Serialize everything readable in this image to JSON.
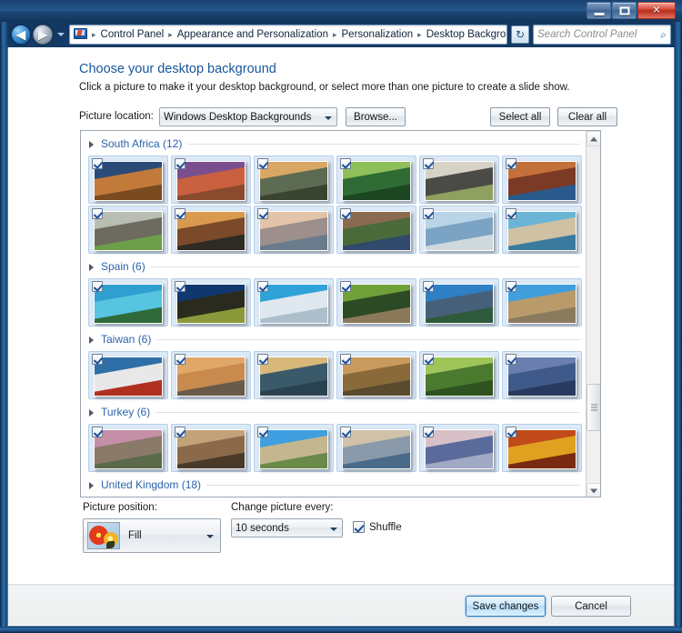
{
  "window": {
    "minimize_label": "Minimize",
    "maximize_label": "Maximize",
    "close_label": "Close",
    "close_glyph": "✕"
  },
  "nav": {
    "back_glyph": "◀",
    "forward_glyph": "▶",
    "refresh_glyph": "↻",
    "breadcrumbs": [
      "Control Panel",
      "Appearance and Personalization",
      "Personalization",
      "Desktop Background"
    ],
    "separator": "▸"
  },
  "search": {
    "placeholder": "Search Control Panel",
    "icon": "search-icon",
    "glyph": "⌕"
  },
  "page": {
    "title": "Choose your desktop background",
    "subtitle": "Click a picture to make it your desktop background, or select more than one picture to create a slide show."
  },
  "location": {
    "label": "Picture location:",
    "value": "Windows Desktop Backgrounds",
    "browse_label": "Browse...",
    "select_all_label": "Select all",
    "clear_all_label": "Clear all"
  },
  "gallery": {
    "sections": [
      {
        "name": "South Africa",
        "count": "(12)",
        "label": "South Africa (12)",
        "rows": [
          [
            {
              "checked": true,
              "c1": "#2a4a78",
              "c2": "#c27a3a",
              "c3": "#7a4a20"
            },
            {
              "checked": true,
              "c1": "#7b4e8e",
              "c2": "#c9603f",
              "c3": "#8a4a2e"
            },
            {
              "checked": true,
              "c1": "#d8a766",
              "c2": "#5d6b52",
              "c3": "#3a4430"
            },
            {
              "checked": true,
              "c1": "#8fbf5a",
              "c2": "#2f6b35",
              "c3": "#1d4622"
            },
            {
              "checked": true,
              "c1": "#d6d2c6",
              "c2": "#4a4a46",
              "c3": "#8fa060"
            },
            {
              "checked": true,
              "c1": "#c4703a",
              "c2": "#7a3a26",
              "c3": "#2a5a8c"
            }
          ],
          [
            {
              "checked": true,
              "c1": "#b9bdb4",
              "c2": "#6d6a60",
              "c3": "#6d9e4a"
            },
            {
              "checked": true,
              "c1": "#d99a4e",
              "c2": "#7b4a2a",
              "c3": "#2e2a24"
            },
            {
              "checked": true,
              "c1": "#e3c3aa",
              "c2": "#9d8f8c",
              "c3": "#6a7b8c"
            },
            {
              "checked": true,
              "c1": "#8a6a50",
              "c2": "#4a6a3a",
              "c3": "#2f4a6a"
            },
            {
              "checked": true,
              "c1": "#b9d4e6",
              "c2": "#7ba3c4",
              "c3": "#cfd9de"
            },
            {
              "checked": true,
              "c1": "#6ab4d6",
              "c2": "#cfc2a4",
              "c3": "#3a7a9e"
            }
          ]
        ]
      },
      {
        "name": "Spain",
        "count": "(6)",
        "label": "Spain (6)",
        "rows": [
          [
            {
              "checked": true,
              "c1": "#2f9fd0",
              "c2": "#57c4e0",
              "c3": "#2e6a3a"
            },
            {
              "checked": true,
              "c1": "#10386e",
              "c2": "#2a2a1e",
              "c3": "#8a9a3a"
            },
            {
              "checked": true,
              "c1": "#2fa3d8",
              "c2": "#dfe8ee",
              "c3": "#aebfcc"
            },
            {
              "checked": true,
              "c1": "#6fa03a",
              "c2": "#2c4a24",
              "c3": "#8a7a5a"
            },
            {
              "checked": true,
              "c1": "#2f7fc4",
              "c2": "#47607a",
              "c3": "#2e5a3a"
            },
            {
              "checked": true,
              "c1": "#3f9fdc",
              "c2": "#b99a6a",
              "c3": "#8a7a5e"
            }
          ]
        ]
      },
      {
        "name": "Taiwan",
        "count": "(6)",
        "label": "Taiwan (6)",
        "rows": [
          [
            {
              "checked": true,
              "c1": "#2f6fa8",
              "c2": "#e8e8e8",
              "c3": "#b03020"
            },
            {
              "checked": true,
              "c1": "#e0a868",
              "c2": "#c98a4e",
              "c3": "#6a5a4a"
            },
            {
              "checked": true,
              "c1": "#d8b87a",
              "c2": "#3a5a6a",
              "c3": "#2a4250"
            },
            {
              "checked": true,
              "c1": "#c99a5e",
              "c2": "#8a6a3a",
              "c3": "#5a4a2e"
            },
            {
              "checked": true,
              "c1": "#9fc45a",
              "c2": "#4a7a2e",
              "c3": "#2e5220"
            },
            {
              "checked": true,
              "c1": "#6a7fae",
              "c2": "#3f5a8a",
              "c3": "#2a3a5e"
            }
          ]
        ]
      },
      {
        "name": "Turkey",
        "count": "(6)",
        "label": "Turkey (6)",
        "rows": [
          [
            {
              "checked": true,
              "c1": "#c58fa8",
              "c2": "#8a7a6a",
              "c3": "#5a6a4a"
            },
            {
              "checked": true,
              "c1": "#c2a278",
              "c2": "#8a6a4a",
              "c3": "#4a3a2a"
            },
            {
              "checked": true,
              "c1": "#3f9fe0",
              "c2": "#c4b68e",
              "c3": "#6a8a4a"
            },
            {
              "checked": true,
              "c1": "#cfc2a8",
              "c2": "#8a9aaa",
              "c3": "#4a6a8a"
            },
            {
              "checked": true,
              "c1": "#d8c0c8",
              "c2": "#5a6a9a",
              "c3": "#9fa8c4"
            },
            {
              "checked": true,
              "c1": "#c04a1a",
              "c2": "#e0a020",
              "c3": "#7a2a10"
            }
          ]
        ]
      },
      {
        "name": "United Kingdom",
        "count": "(18)",
        "label": "United Kingdom (18)",
        "rows": []
      }
    ]
  },
  "picture_position": {
    "label": "Picture position:",
    "value": "Fill"
  },
  "change_every": {
    "label": "Change picture every:",
    "value": "10 seconds"
  },
  "shuffle": {
    "label": "Shuffle",
    "checked": true
  },
  "footer": {
    "save_label": "Save changes",
    "cancel_label": "Cancel"
  }
}
